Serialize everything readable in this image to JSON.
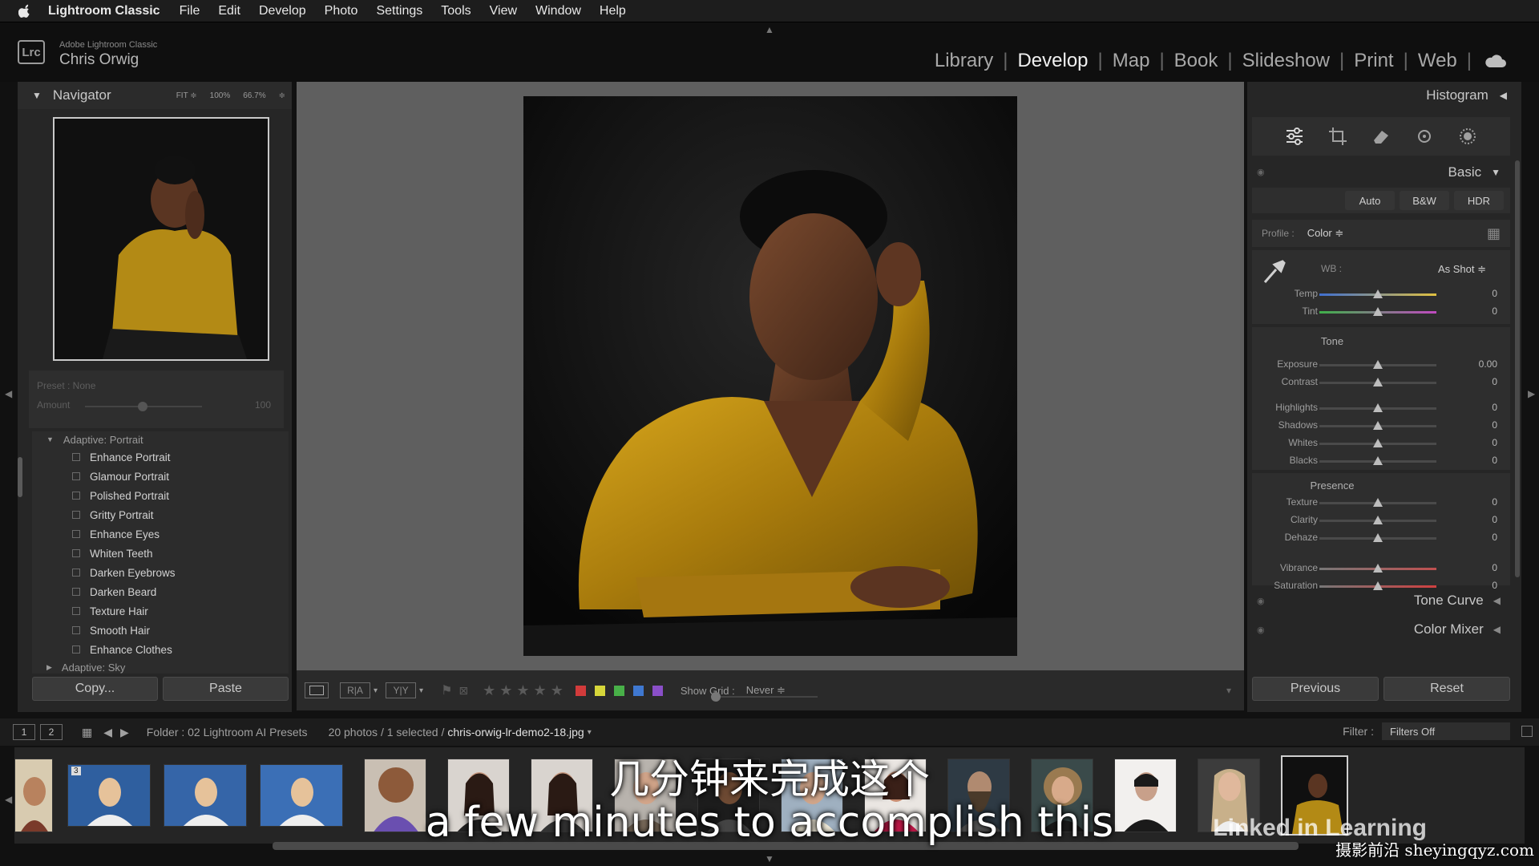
{
  "menubar": {
    "app": "Lightroom Classic",
    "items": [
      "File",
      "Edit",
      "Develop",
      "Photo",
      "Settings",
      "Tools",
      "View",
      "Window",
      "Help"
    ]
  },
  "identity": {
    "subtitle": "Adobe Lightroom Classic",
    "user": "Chris Orwig",
    "logo_text": "Lrc"
  },
  "modules": [
    "Library",
    "Develop",
    "Map",
    "Book",
    "Slideshow",
    "Print",
    "Web"
  ],
  "active_module": "Develop",
  "navigator": {
    "title": "Navigator",
    "zoom_options": [
      "FIT ≑",
      "100%",
      "66.7%",
      "≑"
    ]
  },
  "presets": {
    "preset_label": "Preset : None",
    "amount_label": "Amount",
    "amount_value": "100",
    "group": "Adaptive: Portrait",
    "items": [
      "Enhance Portrait",
      "Glamour Portrait",
      "Polished Portrait",
      "Gritty Portrait",
      "Enhance Eyes",
      "Whiten Teeth",
      "Darken Eyebrows",
      "Darken Beard",
      "Texture Hair",
      "Smooth Hair",
      "Enhance Clothes"
    ],
    "next_group": "Adaptive: Sky"
  },
  "left_buttons": {
    "copy": "Copy...",
    "paste": "Paste"
  },
  "toolbar": {
    "show_grid_label": "Show Grid :",
    "show_grid_value": "Never ≑",
    "stars": "★★★★★",
    "swatches": [
      "#d23b3b",
      "#d6d63a",
      "#48b048",
      "#3f78d0",
      "#8a4fc8"
    ]
  },
  "right_panel": {
    "histogram": "Histogram",
    "basic": "Basic",
    "treatment": [
      "Auto",
      "B&W",
      "HDR"
    ],
    "profile_label": "Profile :",
    "profile_value": "Color ≑",
    "wb_label": "WB :",
    "wb_value": "As Shot ≑",
    "wb_sliders": [
      {
        "label": "Temp",
        "value": "0",
        "pos": 0.5
      },
      {
        "label": "Tint",
        "value": "0",
        "pos": 0.5
      }
    ],
    "tone_title": "Tone",
    "tone_sliders": [
      {
        "label": "Exposure",
        "value": "0.00",
        "pos": 0.5
      },
      {
        "label": "Contrast",
        "value": "0",
        "pos": 0.5
      },
      {
        "label": "Highlights",
        "value": "0",
        "pos": 0.5
      },
      {
        "label": "Shadows",
        "value": "0",
        "pos": 0.5
      },
      {
        "label": "Whites",
        "value": "0",
        "pos": 0.5
      },
      {
        "label": "Blacks",
        "value": "0",
        "pos": 0.5
      }
    ],
    "presence_title": "Presence",
    "presence_sliders": [
      {
        "label": "Texture",
        "value": "0",
        "pos": 0.5
      },
      {
        "label": "Clarity",
        "value": "0",
        "pos": 0.5
      },
      {
        "label": "Dehaze",
        "value": "0",
        "pos": 0.5
      },
      {
        "label": "Vibrance",
        "value": "0",
        "pos": 0.5
      },
      {
        "label": "Saturation",
        "value": "0",
        "pos": 0.5
      }
    ],
    "tone_curve": "Tone Curve",
    "color_mixer": "Color Mixer",
    "previous": "Previous",
    "reset": "Reset"
  },
  "filmbar": {
    "pages": [
      "1",
      "2"
    ],
    "folder": "Folder : 02 Lightroom AI Presets",
    "count": "20 photos / 1 selected /",
    "filename": "chris-orwig-lr-demo2-18.jpg",
    "filter_label": "Filter :",
    "filter_value": "Filters Off"
  },
  "filmstrip": {
    "stack_badge": "3"
  },
  "subtitles": {
    "zh": "几分钟来完成这个",
    "en": "a few minutes to accomplish this"
  },
  "watermarks": {
    "linkedin": "Linked in Learning",
    "site": "摄影前沿 sheyingqyz.com"
  }
}
